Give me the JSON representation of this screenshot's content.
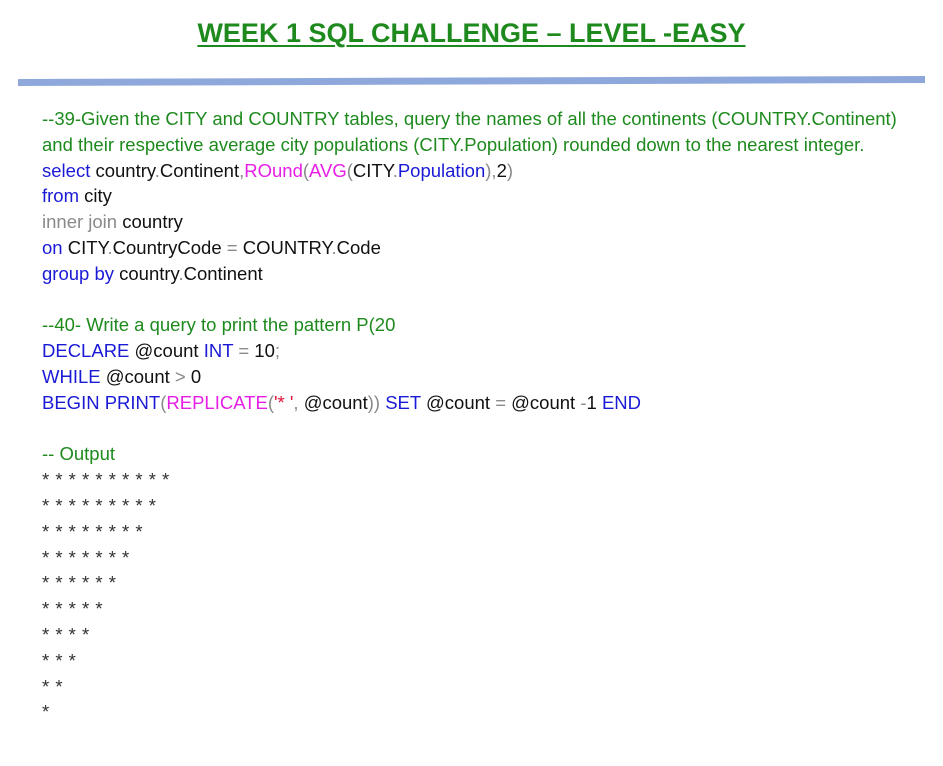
{
  "title": "WEEK 1 SQL CHALLENGE – LEVEL -EASY",
  "q39": {
    "comment": "--39-Given the CITY and COUNTRY tables, query the names of all the continents (COUNTRY.Continent) and their respective average city populations (CITY.Population) rounded down to the nearest integer.",
    "l1": {
      "select": "select",
      "a": "country",
      "dot1": ".",
      "b": "Continent",
      "comma1": ",",
      "round": "ROund",
      "p1": "(",
      "avg": "AVG",
      "p2": "(",
      "c": "CITY",
      "dot2": ".",
      "d": "Population",
      "p3": "),",
      "e": "2",
      "p4": ")"
    },
    "l2": {
      "kw": "from",
      "t": "city"
    },
    "l3": {
      "kw": "inner join",
      "t": "country"
    },
    "l4": {
      "kw": "on",
      "a": "CITY",
      "dot1": ".",
      "b": "CountryCode",
      "eq": "=",
      "c": "COUNTRY",
      "dot2": ".",
      "d": "Code"
    },
    "l5": {
      "kw": "group by",
      "a": "country",
      "dot": ".",
      "b": "Continent"
    }
  },
  "q40": {
    "comment": "--40- Write a query to print the pattern P(20",
    "l1": {
      "kw": "DECLARE",
      "var": "@count",
      "type": "INT",
      "eq": "=",
      "val": "10",
      "semi": ";"
    },
    "l2": {
      "kw": "WHILE",
      "var": "@count",
      "gt": ">",
      "val": "0"
    },
    "l3": {
      "kw1": "BEGIN",
      "kw2": "PRINT",
      "p1": "(",
      "fn": "REPLICATE",
      "p2": "(",
      "str": "'* '",
      "comma": ",",
      "var": "@count",
      "p3": "))",
      "kw3": "SET",
      "var2": "@count",
      "eq": "=",
      "var3": "@count",
      "minus": "-",
      "num": "1",
      "kw4": "END"
    }
  },
  "output": {
    "label": "-- Output",
    "rows": [
      "* * * * * * * * * *",
      "* * * * * * * * *",
      "* * * * * * * *",
      "* * * * * * *",
      "* * * * * *",
      "* * * * *",
      "* * * *",
      "* * *",
      "* *",
      "*"
    ]
  },
  "colors": {
    "title": "#1e8a1e",
    "comment": "#1e8a1e",
    "keyword": "#1a1ad6",
    "function": "#e61ee6",
    "join": "#8a8a8a",
    "string": "#e0103a",
    "rule": "#8fa8dc"
  }
}
